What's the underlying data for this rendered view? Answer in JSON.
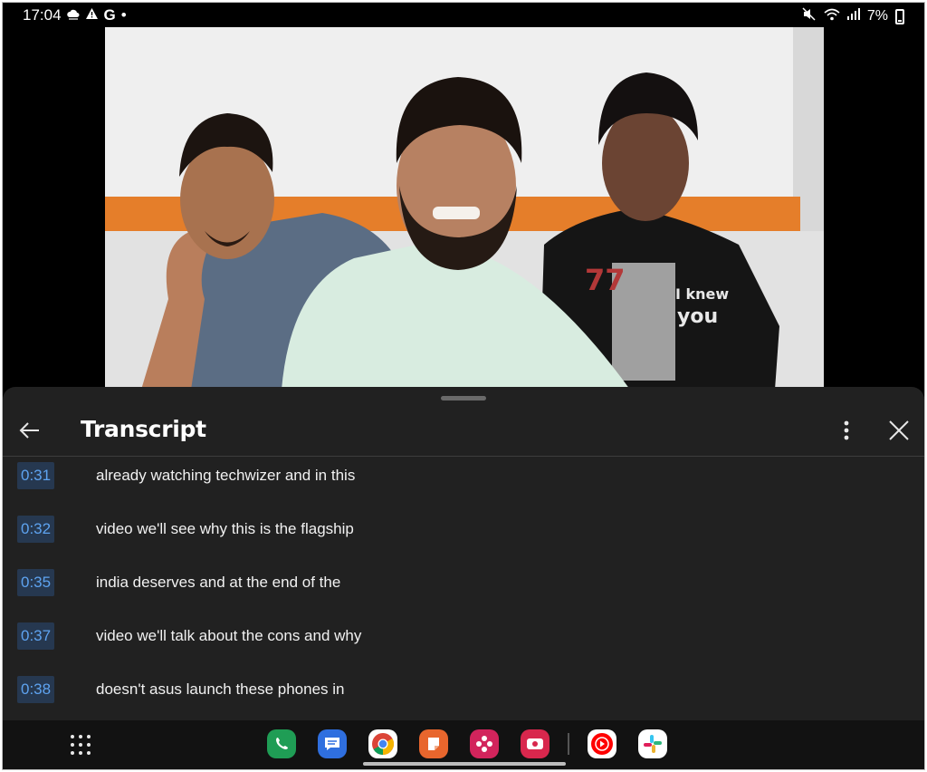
{
  "status_bar": {
    "time": "17:04",
    "notification_g": "G",
    "dot": "•",
    "battery": "7%",
    "icons": [
      "cloud-icon",
      "alert-icon",
      "mute-icon",
      "wifi-icon",
      "signal-icon",
      "battery-icon"
    ]
  },
  "video": {
    "icon": "video-frame"
  },
  "transcript": {
    "title": "Transcript",
    "back_icon": "arrow-left-icon",
    "more_icon": "more-vert-icon",
    "close_icon": "close-icon",
    "lines": [
      {
        "time": "0:31",
        "text": "already watching techwizer and in this"
      },
      {
        "time": "0:32",
        "text": "video we'll see why this is the flagship"
      },
      {
        "time": "0:35",
        "text": "india deserves and at the end of the"
      },
      {
        "time": "0:37",
        "text": "video we'll talk about the cons and why"
      },
      {
        "time": "0:38",
        "text": "doesn't asus launch these phones in"
      }
    ]
  },
  "navbar": {
    "apps": [
      {
        "name": "phone",
        "color": "#1f9d55"
      },
      {
        "name": "messages",
        "color": "#2f6fdf"
      },
      {
        "name": "chrome",
        "color": "#ffffff"
      },
      {
        "name": "notes",
        "color": "#e8662d"
      },
      {
        "name": "bixby",
        "color": "#d2245c"
      },
      {
        "name": "screen-recorder",
        "color": "#d8274d"
      },
      {
        "name": "youtube-music",
        "color": "#ffffff"
      },
      {
        "name": "slack",
        "color": "#ffffff"
      }
    ]
  }
}
